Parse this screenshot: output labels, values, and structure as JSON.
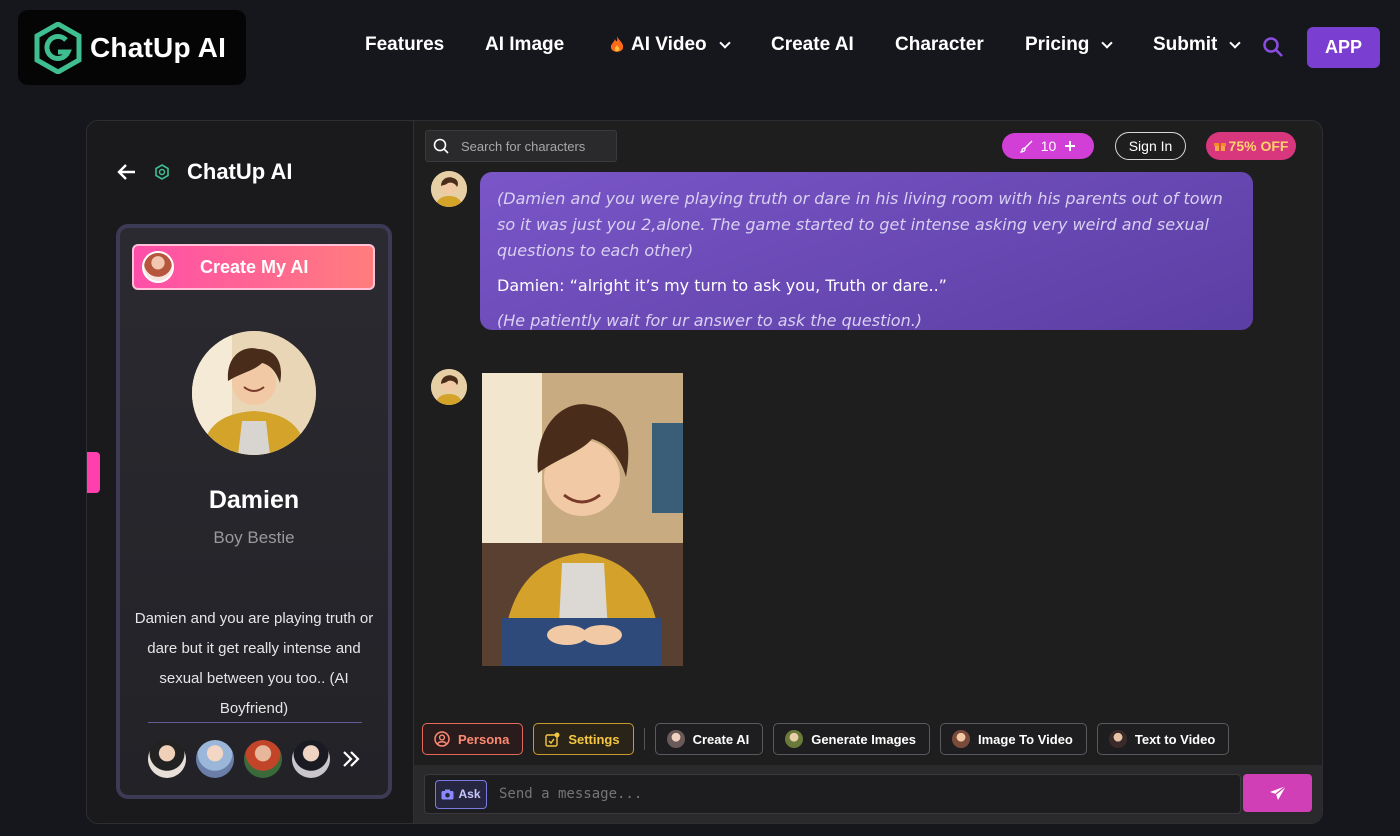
{
  "brand": {
    "name": "ChatUp AI",
    "accent": "#7a3fd0",
    "logo_color": "#3fbf8f"
  },
  "nav": {
    "features": "Features",
    "ai_image": "AI Image",
    "ai_video": "AI Video",
    "create_ai": "Create AI",
    "character": "Character",
    "pricing": "Pricing",
    "submit": "Submit",
    "app": "APP"
  },
  "sidebar": {
    "title": "ChatUp AI",
    "create_button": "Create My AI",
    "character": {
      "name": "Damien",
      "tagline": "Boy Bestie",
      "description": "Damien and you are playing truth or dare but it get really intense and sexual between you too.. (AI Boyfriend)"
    }
  },
  "header": {
    "search_placeholder": "Search for characters",
    "credits": "10",
    "sign_in": "Sign In",
    "discount": "75% OFF"
  },
  "messages": {
    "intro_italic": "(Damien and you were playing truth or dare in his living room with his parents out of town so it was just you 2,alone. The game started to get intense asking very weird and sexual questions to each other)",
    "line": "Damien: “alright it’s my turn to ask you, Truth or dare..”",
    "outro_italic": "(He patiently wait for ur answer to ask the question.)"
  },
  "tools": {
    "persona": "Persona",
    "settings": "Settings",
    "create_ai": "Create AI",
    "generate_images": "Generate Images",
    "image_to_video": "Image To Video",
    "text_to_video": "Text to Video"
  },
  "composer": {
    "ask": "Ask",
    "placeholder": "Send a message..."
  }
}
